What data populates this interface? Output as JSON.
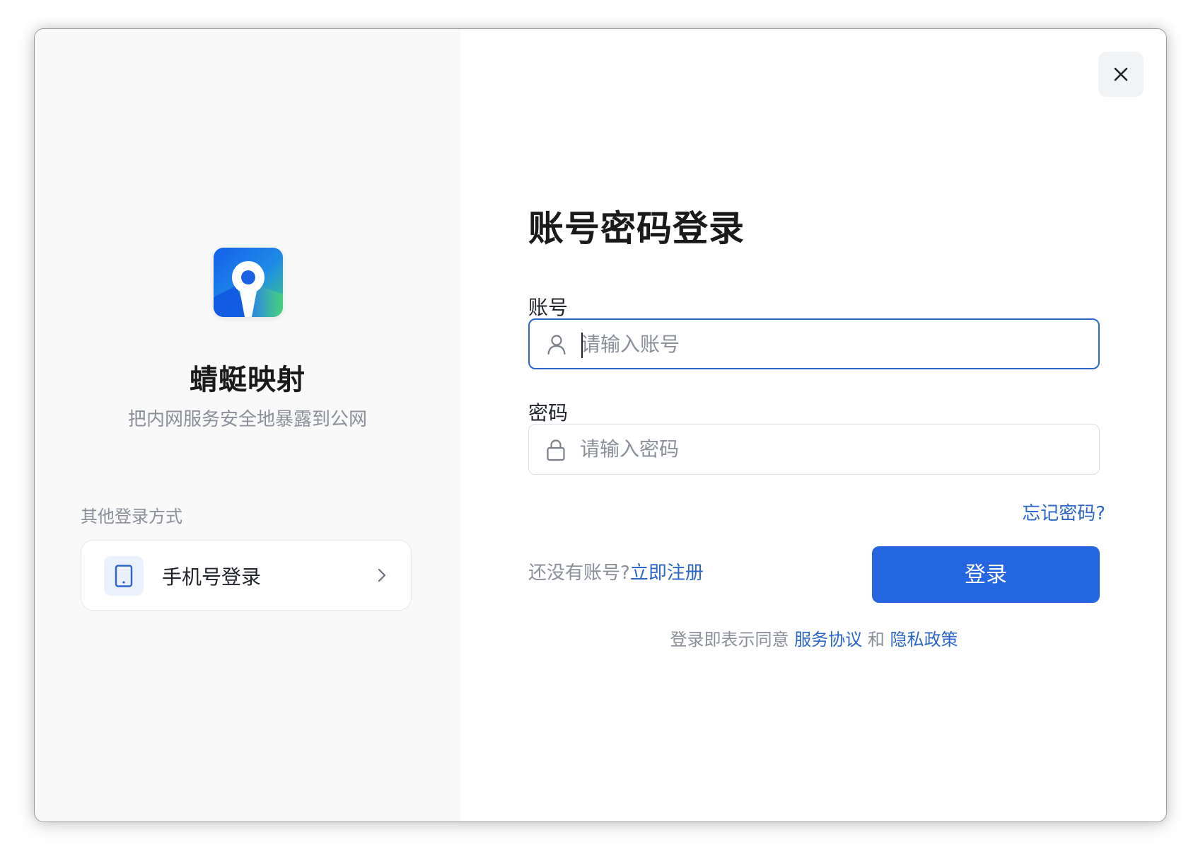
{
  "brand": {
    "app_name": "蜻蜓映射",
    "slogan": "把内网服务安全地暴露到公网",
    "colors": {
      "primary": "#2465e0",
      "link": "#2b66c8",
      "logo_blue": "#1565e6",
      "logo_green": "#3ccf7a"
    }
  },
  "left_panel": {
    "other_methods_label": "其他登录方式",
    "phone_login": {
      "icon": "phone-icon",
      "label": "手机号登录",
      "chevron": "chevron-right-icon"
    }
  },
  "form": {
    "title": "账号密码登录",
    "account": {
      "label": "账号",
      "placeholder": "请输入账号",
      "value": "",
      "icon": "user-icon"
    },
    "password": {
      "label": "密码",
      "placeholder": "请输入密码",
      "value": "",
      "icon": "lock-icon"
    },
    "forgot_password": "忘记密码?",
    "no_account_text": "还没有账号?",
    "register_link": "立即注册",
    "login_button": "登录",
    "agreement": {
      "prefix": "登录即表示同意",
      "terms": "服务协议",
      "and": "和",
      "privacy": "隐私政策"
    }
  },
  "window": {
    "close_icon": "close-icon"
  }
}
